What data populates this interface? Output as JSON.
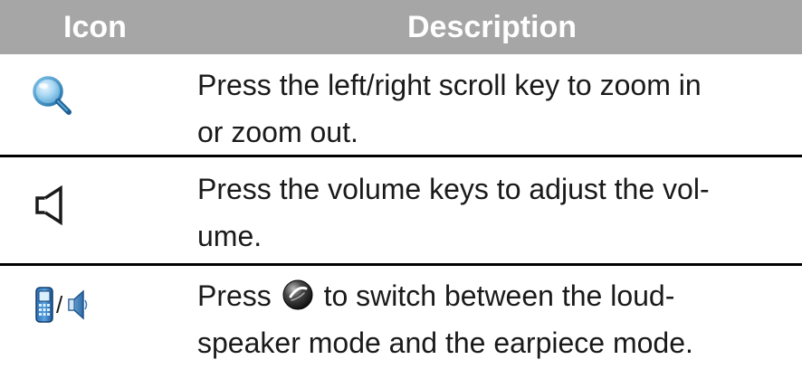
{
  "table": {
    "headers": {
      "icon": "Icon",
      "description": "Description"
    },
    "rows": [
      {
        "icon_names": [
          "zoom-magnifier-icon"
        ],
        "description_lines": [
          "Press the left/right scroll key to zoom in",
          "or zoom out."
        ]
      },
      {
        "icon_names": [
          "volume-speaker-outline-icon"
        ],
        "description_lines": [
          "Press the volume keys to adjust the vol-",
          "ume."
        ]
      },
      {
        "icon_names": [
          "handset-phone-icon",
          "loudspeaker-icon"
        ],
        "icon_separator": "/",
        "description_before_icon": "Press",
        "inline_icon_name": "center-key-button-icon",
        "description_after_icon": "to switch between the loud-",
        "description_line2": "speaker mode and the earpiece mode."
      }
    ]
  },
  "colors": {
    "header_background": "#a6a6a6",
    "header_text": "#ffffff",
    "body_text": "#1a1a1a",
    "divider": "#000000"
  }
}
